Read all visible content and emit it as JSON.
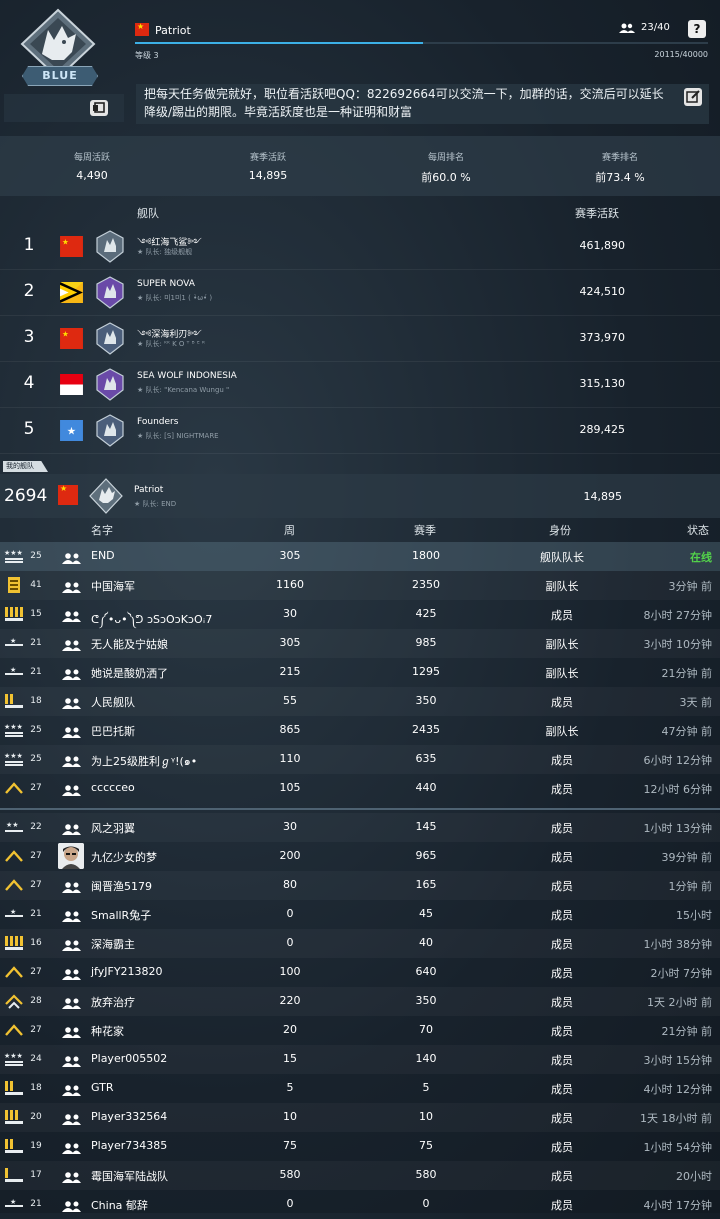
{
  "fleet": {
    "emblem_name": "BLUE",
    "name": "Patriot",
    "level_label": "等级 3",
    "member_count": "23/40",
    "exp": "20115/40000",
    "exp_progress": 0.503,
    "help_label": "?",
    "notice": "把每天任务做完就好，职位看活跃吧QQ：822692664可以交流一下，加群的话，交流后可以延长降级/踢出的期限。毕竟活跃度也是一种证明和财富"
  },
  "stats": [
    {
      "label": "每周活跃",
      "value": "4,490"
    },
    {
      "label": "赛季活跃",
      "value": "14,895"
    },
    {
      "label": "每周排名",
      "value": "前60.0 %"
    },
    {
      "label": "赛季排名",
      "value": "前73.4 %"
    }
  ],
  "ranking": {
    "header_fleet": "舰队",
    "header_score": "赛季活跃",
    "rows": [
      {
        "rank": "1",
        "flag": "cn",
        "name": "༺红海飞鲨༻",
        "captain": "队长: 独级舰舰",
        "score": "461,890"
      },
      {
        "rank": "2",
        "flag": "bt",
        "name": "SUPER NOVA",
        "captain": "队长: 미1미1 ( •̀ω•́ )",
        "score": "424,510"
      },
      {
        "rank": "3",
        "flag": "cn",
        "name": "༺深海利刃༻",
        "captain": "队长: ᴷᴷ K O ᵀ ᴮ ᴱ ᴿ",
        "score": "373,970"
      },
      {
        "rank": "4",
        "flag": "id",
        "name": "SEA WOLF INDONESIA",
        "captain": "队长: \"Kencana Wungu \"",
        "score": "315,130"
      },
      {
        "rank": "5",
        "flag": "so",
        "name": "Founders",
        "captain": "队长: [S] NIGHTMARE",
        "score": "289,425"
      }
    ],
    "my_fleet_tag": "我的舰队",
    "my_fleet": {
      "rank": "2694",
      "flag": "cn",
      "name": "Patriot",
      "captain": "队长: END",
      "score": "14,895"
    }
  },
  "members": {
    "headers": {
      "name": "名字",
      "week": "周",
      "season": "赛季",
      "role": "身份",
      "status": "状态"
    },
    "rows": [
      {
        "level": "25",
        "name": "END",
        "week": "305",
        "season": "1800",
        "role": "舰队队长",
        "status": "在线",
        "icon": "stars3"
      },
      {
        "level": "41",
        "name": "中国海军",
        "week": "1160",
        "season": "2350",
        "role": "副队长",
        "status": "3分钟 前",
        "icon": "gold"
      },
      {
        "level": "15",
        "name": "ᕦ༼•ᴗ•༽ᕤ ɔSɔOɔKɔOꜟ7",
        "week": "30",
        "season": "425",
        "role": "成员",
        "status": "8小时 27分钟",
        "icon": "bars4"
      },
      {
        "level": "21",
        "name": "无人能及宁姑娘",
        "week": "305",
        "season": "985",
        "role": "副队长",
        "status": "3小时 10分钟",
        "icon": "star1"
      },
      {
        "level": "21",
        "name": "她说是酸奶洒了",
        "week": "215",
        "season": "1295",
        "role": "副队长",
        "status": "21分钟 前",
        "icon": "star1"
      },
      {
        "level": "18",
        "name": "人民舰队",
        "week": "55",
        "season": "350",
        "role": "成员",
        "status": "3天 前",
        "icon": "bars2"
      },
      {
        "level": "25",
        "name": "巴巴托斯",
        "week": "865",
        "season": "2435",
        "role": "副队长",
        "status": "47分钟 前",
        "icon": "stars3"
      },
      {
        "level": "25",
        "name": "为上25级胜利ℊᵞ!(๑•",
        "week": "110",
        "season": "635",
        "role": "成员",
        "status": "6小时 12分钟",
        "icon": "stars3"
      },
      {
        "level": "27",
        "name": "ccccceo",
        "week": "105",
        "season": "440",
        "role": "成员",
        "status": "12小时 6分钟",
        "icon": "chev"
      },
      {
        "level": "22",
        "name": "风之羽翼",
        "week": "30",
        "season": "145",
        "role": "成员",
        "status": "1小时 13分钟",
        "icon": "stars2"
      },
      {
        "level": "27",
        "name": "九亿少女的梦",
        "week": "200",
        "season": "965",
        "role": "成员",
        "status": "39分钟 前",
        "icon": "chev",
        "avatar": true
      },
      {
        "level": "27",
        "name": "闽晋渔5179",
        "week": "80",
        "season": "165",
        "role": "成员",
        "status": "1分钟 前",
        "icon": "chev"
      },
      {
        "level": "21",
        "name": "SmallR兔子",
        "week": "0",
        "season": "45",
        "role": "成员",
        "status": "15小时",
        "icon": "star1"
      },
      {
        "level": "16",
        "name": "深海霸主",
        "week": "0",
        "season": "40",
        "role": "成员",
        "status": "1小时 38分钟",
        "icon": "bars4"
      },
      {
        "level": "27",
        "name": "jfyJFY213820",
        "week": "100",
        "season": "640",
        "role": "成员",
        "status": "2小时 7分钟",
        "icon": "chev"
      },
      {
        "level": "28",
        "name": "放弃治疗",
        "week": "220",
        "season": "350",
        "role": "成员",
        "status": "1天 2小时 前",
        "icon": "chev2"
      },
      {
        "level": "27",
        "name": "种花家",
        "week": "20",
        "season": "70",
        "role": "成员",
        "status": "21分钟 前",
        "icon": "chev"
      },
      {
        "level": "24",
        "name": "Player005502",
        "week": "15",
        "season": "140",
        "role": "成员",
        "status": "3小时 15分钟",
        "icon": "stars3"
      },
      {
        "level": "18",
        "name": "GTR",
        "week": "5",
        "season": "5",
        "role": "成员",
        "status": "4小时 12分钟",
        "icon": "bars2"
      },
      {
        "level": "20",
        "name": "Player332564",
        "week": "10",
        "season": "10",
        "role": "成员",
        "status": "1天 18小时 前",
        "icon": "bars3"
      },
      {
        "level": "19",
        "name": "Player734385",
        "week": "75",
        "season": "75",
        "role": "成员",
        "status": "1小时 54分钟",
        "icon": "bars2"
      },
      {
        "level": "17",
        "name": "霉国海军陆战队",
        "week": "580",
        "season": "580",
        "role": "成员",
        "status": "20小时",
        "icon": "bars1"
      },
      {
        "level": "21",
        "name": "China 郁辞",
        "week": "0",
        "season": "0",
        "role": "成员",
        "status": "4小时 17分钟",
        "icon": "star1"
      }
    ]
  },
  "colors": {
    "online": "#53d34a",
    "accent": "#3cb0e6"
  }
}
